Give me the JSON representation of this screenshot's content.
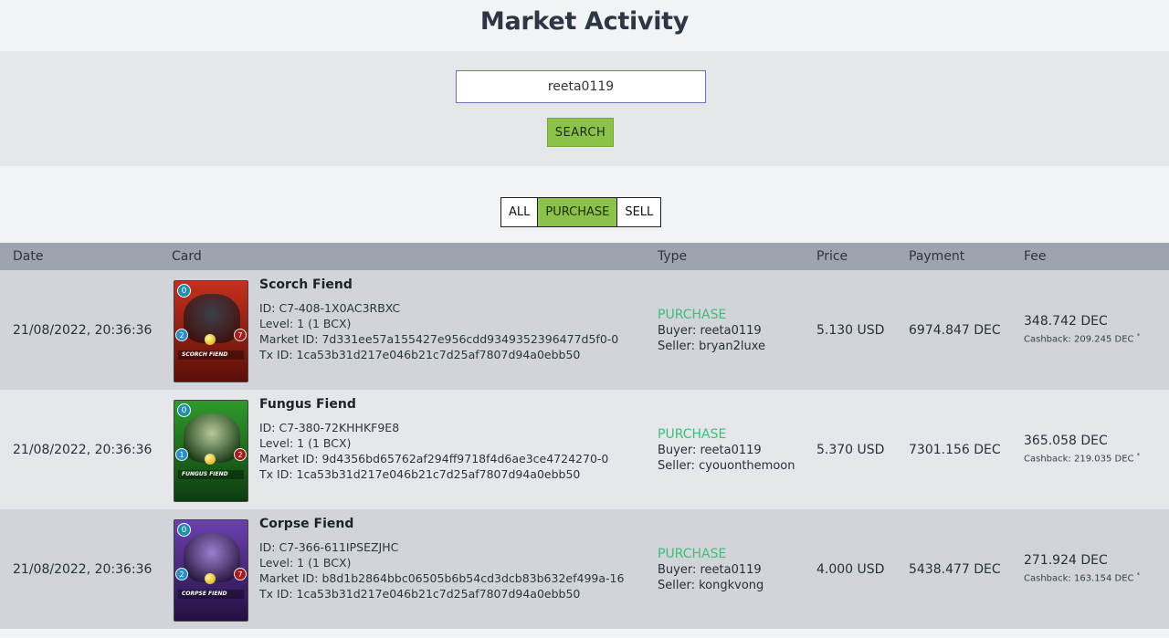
{
  "header": {
    "title": "Market Activity"
  },
  "search": {
    "value": "reeta0119",
    "button_label": "SEARCH"
  },
  "filters": [
    {
      "label": "ALL",
      "active": false
    },
    {
      "label": "PURCHASE",
      "active": true
    },
    {
      "label": "SELL",
      "active": false
    }
  ],
  "table": {
    "columns": [
      "Date",
      "Card",
      "Type",
      "Price",
      "Payment",
      "Fee"
    ],
    "rows": [
      {
        "date": "21/08/2022, 20:36:36",
        "card": {
          "name": "Scorch Fiend",
          "banner": "SCORCH FIEND",
          "mana": "0",
          "attack": "2",
          "health": "7",
          "id": "ID: C7-408-1X0AC3RBXC",
          "level": "Level: 1 (1 BCX)",
          "market_id": "Market ID: 7d331ee57a155427e956cdd9349352396477d5f0-0",
          "tx_id": "Tx ID: 1ca53b31d217e046b21c7d25af7807d94a0ebb50",
          "color_top": "#c4301c",
          "color_bottom": "#5a0f08",
          "creature_color": "#3b3f4a"
        },
        "type": "PURCHASE",
        "buyer": "Buyer: reeta0119",
        "seller": "Seller: bryan2luxe",
        "price": "5.130 USD",
        "payment": "6974.847 DEC",
        "fee": "348.742 DEC",
        "cashback": "Cashback: 209.245 DEC"
      },
      {
        "date": "21/08/2022, 20:36:36",
        "card": {
          "name": "Fungus Fiend",
          "banner": "FUNGUS FIEND",
          "mana": "0",
          "attack": "1",
          "health": "2",
          "id": "ID: C7-380-72KHHKF9E8",
          "level": "Level: 1 (1 BCX)",
          "market_id": "Market ID: 9d4356bd65762af294ff9718f4d6ae3ce4724270-0",
          "tx_id": "Tx ID: 1ca53b31d217e046b21c7d25af7807d94a0ebb50",
          "color_top": "#2e9a2a",
          "color_bottom": "#0d3d10",
          "creature_color": "#b7c89a"
        },
        "type": "PURCHASE",
        "buyer": "Buyer: reeta0119",
        "seller": "Seller: cyouonthemoon",
        "price": "5.370 USD",
        "payment": "7301.156 DEC",
        "fee": "365.058 DEC",
        "cashback": "Cashback: 219.035 DEC"
      },
      {
        "date": "21/08/2022, 20:36:36",
        "card": {
          "name": "Corpse Fiend",
          "banner": "CORPSE FIEND",
          "mana": "0",
          "attack": "2",
          "health": "7",
          "id": "ID: C7-366-611IPSEZJHC",
          "level": "Level: 1 (1 BCX)",
          "market_id": "Market ID: b8d1b2864bbc06505b6b54cd3dcb83b632ef499a-16",
          "tx_id": "Tx ID: 1ca53b31d217e046b21c7d25af7807d94a0ebb50",
          "color_top": "#6c3fb0",
          "color_bottom": "#231040",
          "creature_color": "#9a7fd0"
        },
        "type": "PURCHASE",
        "buyer": "Buyer: reeta0119",
        "seller": "Seller: kongkvong",
        "price": "4.000 USD",
        "payment": "5438.477 DEC",
        "fee": "271.924 DEC",
        "cashback": "Cashback: 163.154 DEC"
      }
    ]
  }
}
